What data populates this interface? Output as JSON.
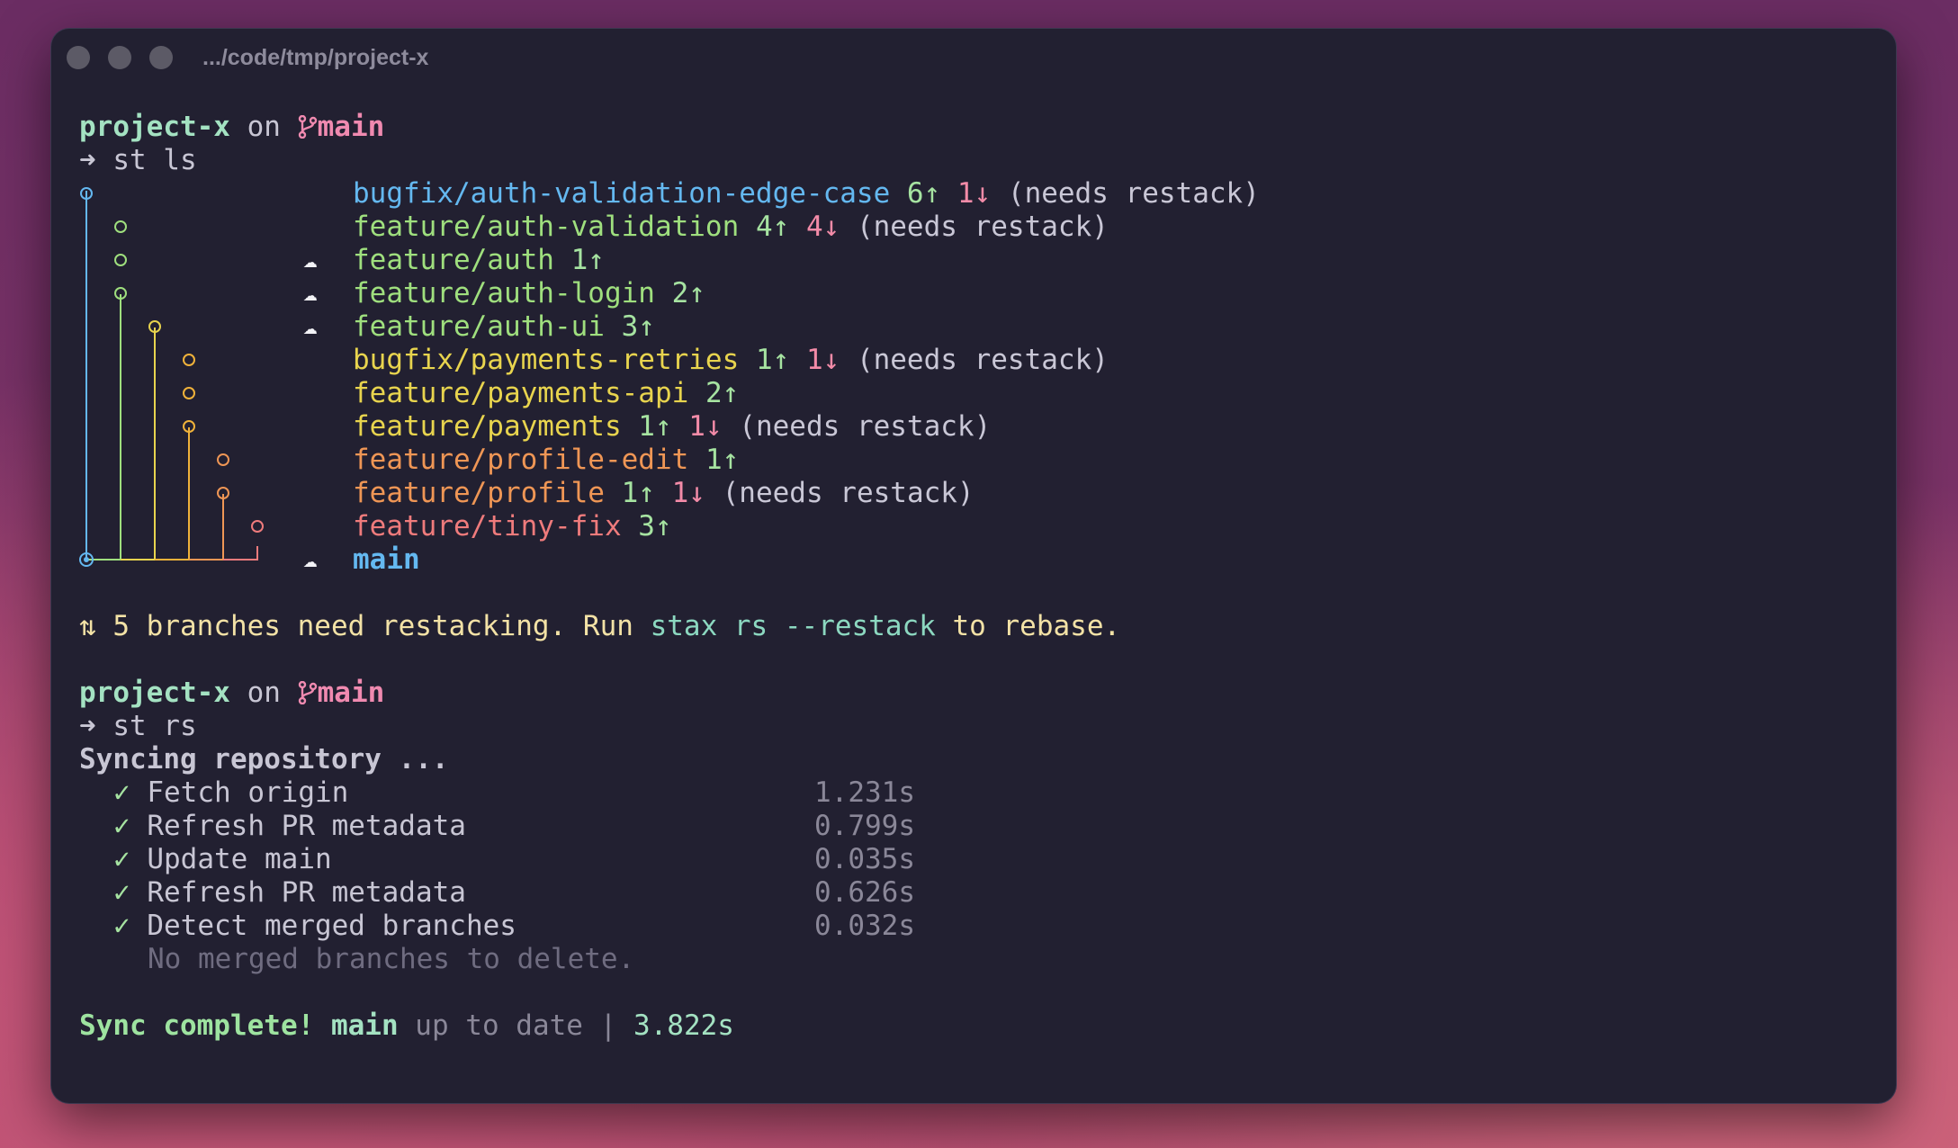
{
  "window": {
    "title": ".../code/tmp/project-x",
    "buttons": [
      "close",
      "minimize",
      "zoom"
    ]
  },
  "prompt1": {
    "dir": "project-x",
    "on": " on ",
    "branch_icon": "git-branch-icon",
    "branch": "main",
    "arrow": "➜",
    "command": "st ls"
  },
  "stack": [
    {
      "name": "bugfix/auth-validation-edge-case",
      "up": "6↑",
      "down": "1↓",
      "note": "(needs restack)",
      "color": "#64b8f0",
      "cloud": false
    },
    {
      "name": "feature/auth-validation",
      "up": "4↑",
      "down": "4↓",
      "note": "(needs restack)",
      "color": "#9fdf7e",
      "cloud": false
    },
    {
      "name": "feature/auth",
      "up": "1↑",
      "down": "",
      "note": "",
      "color": "#9fdf7e",
      "cloud": true
    },
    {
      "name": "feature/auth-login",
      "up": "2↑",
      "down": "",
      "note": "",
      "color": "#9fdf7e",
      "cloud": true
    },
    {
      "name": "feature/auth-ui",
      "up": "3↑",
      "down": "",
      "note": "",
      "color": "#9fdf7e",
      "cloud": true
    },
    {
      "name": "bugfix/payments-retries",
      "up": "1↑",
      "down": "1↓",
      "note": "(needs restack)",
      "color": "#e8d44e",
      "cloud": false
    },
    {
      "name": "feature/payments-api",
      "up": "2↑",
      "down": "",
      "note": "",
      "color": "#e8d44e",
      "cloud": false
    },
    {
      "name": "feature/payments",
      "up": "1↑",
      "down": "1↓",
      "note": "(needs restack)",
      "color": "#e8d44e",
      "cloud": false
    },
    {
      "name": "feature/profile-edit",
      "up": "1↑",
      "down": "",
      "note": "",
      "color": "#ef9655",
      "cloud": false
    },
    {
      "name": "feature/profile",
      "up": "1↑",
      "down": "1↓",
      "note": "(needs restack)",
      "color": "#ef9655",
      "cloud": false
    },
    {
      "name": "feature/tiny-fix",
      "up": "3↑",
      "down": "",
      "note": "",
      "color": "#ef7b7c",
      "cloud": false
    },
    {
      "name": "main",
      "up": "",
      "down": "",
      "note": "",
      "color": "#64b8f0",
      "cloud": true
    }
  ],
  "restack_msg": {
    "icon": "⇅",
    "text1": " 5 branches need restacking. Run ",
    "cmd": "stax rs --restack",
    "text2": " to rebase."
  },
  "prompt2": {
    "dir": "project-x",
    "on": " on ",
    "branch_icon": "git-branch-icon",
    "branch": "main",
    "arrow": "➜",
    "command": "st rs"
  },
  "sync": {
    "heading": "Syncing repository ...",
    "steps": [
      {
        "check": "✓",
        "label": "Fetch origin",
        "time": "1.231s"
      },
      {
        "check": "✓",
        "label": "Refresh PR metadata",
        "time": "0.799s"
      },
      {
        "check": "✓",
        "label": "Update main",
        "time": "0.035s"
      },
      {
        "check": "✓",
        "label": "Refresh PR metadata",
        "time": "0.626s"
      },
      {
        "check": "✓",
        "label": "Detect merged branches",
        "time": "0.032s"
      }
    ],
    "note": "No merged branches to delete.",
    "complete": "Sync complete!",
    "branch": "main",
    "status": "up to date",
    "sep": "|",
    "total": "3.822s"
  },
  "colors": {
    "terminal_bg": "#222031",
    "prompt_dir": "#a4e2c2",
    "prompt_branch": "#f08ab0",
    "ahead": "#a6e3a1",
    "behind": "#f38ba8"
  }
}
